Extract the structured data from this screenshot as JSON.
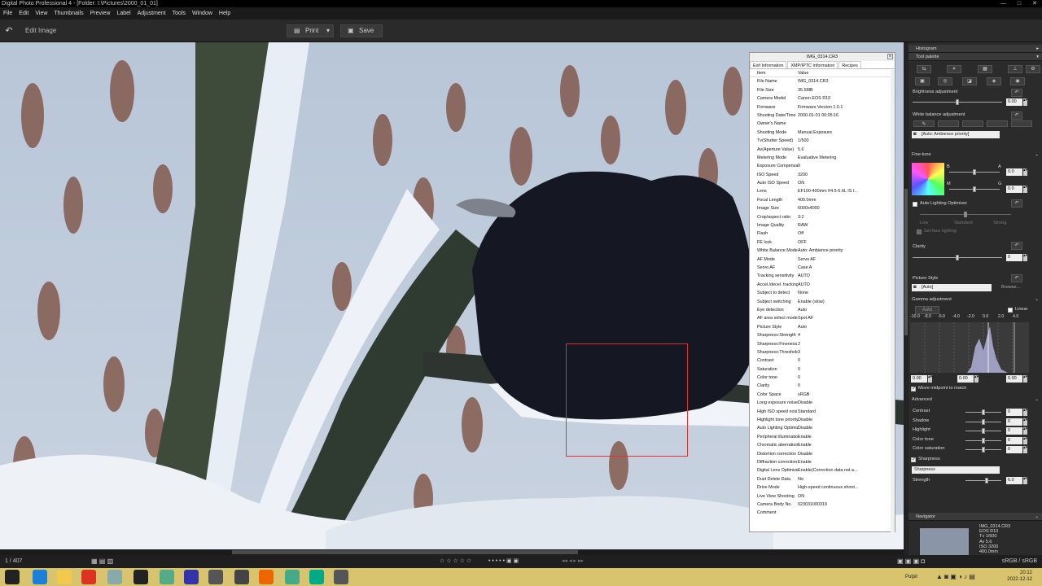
{
  "window": {
    "title": "Digital Photo Professional 4 - [Folder: I:\\Pictures\\2000_01_01]"
  },
  "menu": [
    "File",
    "Edit",
    "View",
    "Thumbnails",
    "Preview",
    "Label",
    "Adjustment",
    "Tools",
    "Window",
    "Help"
  ],
  "toolbar": {
    "mode_title": "Edit Image",
    "print_label": "Print",
    "save_label": "Save"
  },
  "exif": {
    "file_title": "IMG_0314.CR3",
    "tabs": [
      "Exif Information",
      "XMP/IPTC Information",
      "Recipes"
    ],
    "col_item": "Item",
    "col_value": "Value",
    "rows": [
      [
        "File Name",
        "IMG_0314.CR3"
      ],
      [
        "File Size",
        "35.5MB"
      ],
      [
        "Camera Model",
        "Canon EOS R10"
      ],
      [
        "Firmware",
        "Firmware Version 1.0.1"
      ],
      [
        "Shooting Date/Time",
        "2000-01-01 00:05:16"
      ],
      [
        "Owner's Name",
        ""
      ],
      [
        "Shooting Mode",
        "Manual Exposure"
      ],
      [
        "Tv(Shutter Speed)",
        "1/500"
      ],
      [
        "Av(Aperture Value)",
        "5.6"
      ],
      [
        "Metering Mode",
        "Evaluative Metering"
      ],
      [
        "Exposure Compensati...",
        "0"
      ],
      [
        "ISO Speed",
        "3200"
      ],
      [
        "Auto ISO Speed",
        "ON"
      ],
      [
        "Lens",
        "EF100-400mm f/4.5-5.6L IS I..."
      ],
      [
        "Focal Length",
        "400.0mm"
      ],
      [
        "Image Size",
        "6000x4000"
      ],
      [
        "Crop/aspect ratio",
        "3:2"
      ],
      [
        "Image Quality",
        "RAW"
      ],
      [
        "Flash",
        "Off"
      ],
      [
        "FE lock",
        "OFF"
      ],
      [
        "White Balance Mode",
        "Auto: Ambience priority"
      ],
      [
        "AF Mode",
        "Servo AF"
      ],
      [
        "Servo AF",
        "Case A"
      ],
      [
        "Tracking sensitivity",
        "AUTO"
      ],
      [
        "Accel./decel. tracking",
        "AUTO"
      ],
      [
        "Subject to detect",
        "None"
      ],
      [
        "Subject switching",
        "Enable (slow)"
      ],
      [
        "Eye detection",
        "Auto"
      ],
      [
        "AF area select mode",
        "Spot AF"
      ],
      [
        "Picture Style",
        "Auto"
      ],
      [
        "Sharpness:Strength",
        "4"
      ],
      [
        "Sharpness:Fineness",
        "2"
      ],
      [
        "Sharpness:Threshold",
        "3"
      ],
      [
        "Contrast",
        "0"
      ],
      [
        "Saturation",
        "0"
      ],
      [
        "Color tone",
        "0"
      ],
      [
        "Clarity",
        "0"
      ],
      [
        "Color Space",
        "sRGB"
      ],
      [
        "Long exposure noise...",
        "Disable"
      ],
      [
        "High ISO speed nois...",
        "Standard"
      ],
      [
        "Highlight tone priority",
        "Disable"
      ],
      [
        "Auto Lighting Optimizer",
        "Disable"
      ],
      [
        "Peripheral illumination...",
        "Enable"
      ],
      [
        "Chromatic aberration...",
        "Enable"
      ],
      [
        "Distortion correction",
        "Disable"
      ],
      [
        "Diffraction correction",
        "Enable"
      ],
      [
        "Digital Lens Optimizer",
        "Enable(Correction data not a..."
      ],
      [
        "Dust Delete Data",
        "No"
      ],
      [
        "Drive Mode",
        "High-speed continuous shoot..."
      ],
      [
        "Live View Shooting",
        "ON"
      ],
      [
        "Camera Body No.",
        "023031000319"
      ],
      [
        "Comment",
        ""
      ]
    ]
  },
  "panel": {
    "histogram": "Histogram",
    "tool_palette": "Tool palette",
    "brightness": {
      "label": "Brightness adjustment",
      "value": "0.00",
      "level": 0.5
    },
    "white_balance": {
      "label": "White balance adjustment",
      "mode": "[Auto: Ambience priority]"
    },
    "fine_tune": {
      "label": "Fine-tune",
      "b": "B",
      "a": "A",
      "m": "M",
      "g": "G",
      "ba_value": "0.0",
      "mg_value": "0.0"
    },
    "alo": {
      "label": "Auto Lighting Optimizer",
      "low": "Low",
      "standard": "Standard",
      "strong": "Strong",
      "face": "Set face lighting"
    },
    "clarity": {
      "label": "Clarity",
      "value": "0",
      "level": 0.5
    },
    "picture_style": {
      "label": "Picture Style",
      "value": "[Auto]",
      "browse": "Browse..."
    },
    "gamma": {
      "label": "Gamma adjustment",
      "auto": "Auto",
      "linear": "Linear",
      "ticks": [
        "-10.0",
        "-8.0",
        "-6.0",
        "-4.0",
        "-2.0",
        "0.0",
        "2.0",
        "4.0"
      ],
      "v1": "0.00",
      "v2": "0.00",
      "v3": "0.00",
      "move_mid": "Move midpoint to match"
    },
    "advanced": {
      "label": "Advanced",
      "rows": [
        [
          "Contrast",
          "0"
        ],
        [
          "Shadow",
          "0"
        ],
        [
          "Highlight",
          "0"
        ],
        [
          "Color tone",
          "0"
        ],
        [
          "Color saturation",
          "0"
        ]
      ]
    },
    "sharpness": {
      "label": "Sharpness",
      "mode": "Sharpness",
      "strength_label": "Strength",
      "strength": "6.0"
    },
    "navigator": {
      "label": "Navigator",
      "info": [
        "IMG_0314.CR3",
        "EOS R10",
        "Tv 1/500",
        "Av 5.6",
        "ISO 3200",
        "400.0mm"
      ]
    }
  },
  "status": {
    "count": "1 / 407",
    "colorspace": "sRGB / sRGB"
  },
  "taskbar": {
    "pulpit": "Pulpit",
    "time": "20:12",
    "date": "2022-12-12"
  }
}
